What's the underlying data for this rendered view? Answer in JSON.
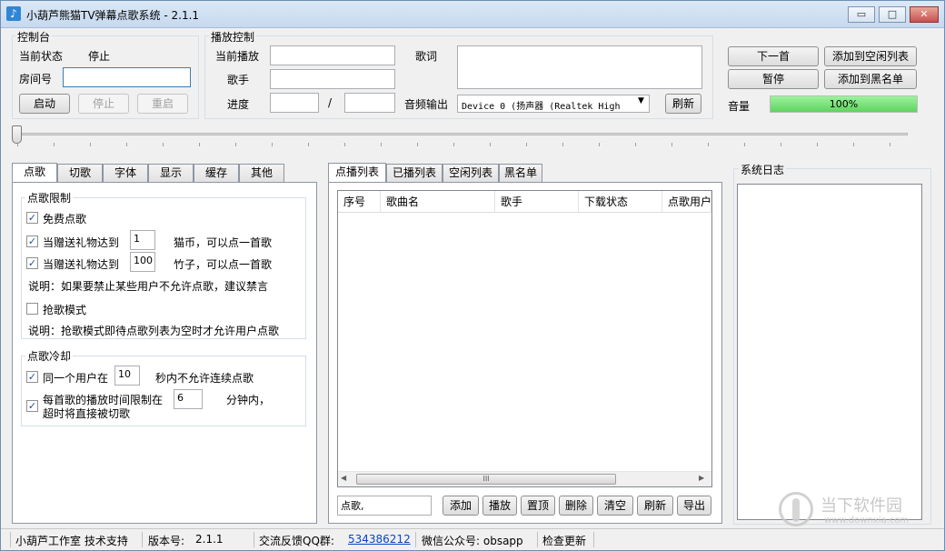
{
  "window": {
    "title": "小葫芦熊猫TV弹幕点歌系统 - 2.1.1",
    "min_label": "▭",
    "max_label": "□",
    "close_label": "✕"
  },
  "console": {
    "title": "控制台",
    "status_label": "当前状态",
    "status_value": "停止",
    "room_label": "房间号",
    "room_value": "",
    "start_label": "启动",
    "stop_label": "停止",
    "restart_label": "重启"
  },
  "playback": {
    "title": "播放控制",
    "current_label": "当前播放",
    "current_value": "",
    "singer_label": "歌手",
    "singer_value": "",
    "progress_label": "进度",
    "progress_value": "",
    "slash": "/",
    "total_value": "",
    "lyrics_label": "歌词",
    "audio_out_label": "音频输出",
    "audio_device": "Device 0 (扬声器 (Realtek High",
    "refresh_label": "刷新"
  },
  "actions": {
    "next_label": "下一首",
    "add_idle_label": "添加到空闲列表",
    "pause_label": "暂停",
    "add_blacklist_label": "添加到黑名单",
    "volume_label": "音量",
    "volume_value": "100%",
    "volume_fraction": 1.0
  },
  "left_tabs": [
    {
      "label": "点歌"
    },
    {
      "label": "切歌"
    },
    {
      "label": "字体"
    },
    {
      "label": "显示"
    },
    {
      "label": "缓存"
    },
    {
      "label": "其他"
    }
  ],
  "request_limit": {
    "title": "点歌限制",
    "free_label": "免费点歌",
    "gift1_prefix": "当赠送礼物达到",
    "gift1_value": "1",
    "gift1_suffix": "猫币，可以点一首歌",
    "gift2_prefix": "当赠送礼物达到",
    "gift2_value": "100",
    "gift2_suffix": "竹子，可以点一首歌",
    "note1": "说明：如果要禁止某些用户不允许点歌，建议禁言",
    "grab_label": "抢歌模式",
    "note2": "说明：抢歌模式即待点歌列表为空时才允许用户点歌"
  },
  "cooldown": {
    "title": "点歌冷却",
    "same_user_prefix": "同一个用户在",
    "same_user_value": "10",
    "same_user_suffix": "秒内不允许连续点歌",
    "time_limit_prefix": "每首歌的播放时间限制在",
    "time_limit_line2": "超时将直接被切歌",
    "time_limit_value": "6",
    "time_limit_suffix": "分钟内，"
  },
  "center_tabs": [
    {
      "label": "点播列表"
    },
    {
      "label": "已播列表"
    },
    {
      "label": "空闲列表"
    },
    {
      "label": "黑名单"
    }
  ],
  "list": {
    "columns": [
      "序号",
      "歌曲名",
      "歌手",
      "下载状态",
      "点歌用户"
    ],
    "scroll_grip": "III"
  },
  "list_actions": {
    "input_value": "点歌,",
    "add": "添加",
    "play": "播放",
    "top": "置顶",
    "delete": "删除",
    "clear": "清空",
    "refresh": "刷新",
    "export": "导出"
  },
  "log": {
    "title": "系统日志"
  },
  "statusbar": {
    "studio": "小葫芦工作室 技术支持",
    "version_label": "版本号:",
    "version_value": "2.1.1",
    "qq_label": "交流反馈QQ群:",
    "qq_value": "534386212",
    "wechat": "微信公众号: obsapp",
    "check_update": "检查更新"
  },
  "watermark": {
    "brand": "当下软件园",
    "url": "www.downxia.com"
  }
}
